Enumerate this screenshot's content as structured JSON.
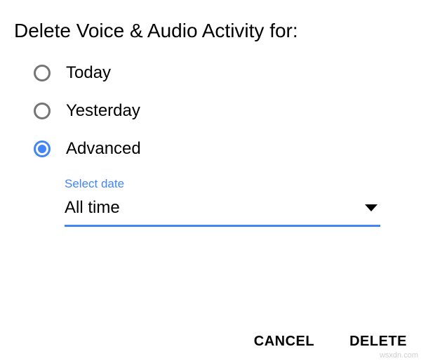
{
  "dialog": {
    "title": "Delete Voice & Audio Activity for:",
    "options": {
      "today": "Today",
      "yesterday": "Yesterday",
      "advanced": "Advanced"
    },
    "selected": "advanced"
  },
  "dateSelector": {
    "label": "Select date",
    "value": "All time"
  },
  "buttons": {
    "cancel": "CANCEL",
    "delete": "DELETE"
  },
  "watermark": "wsxdn.com"
}
